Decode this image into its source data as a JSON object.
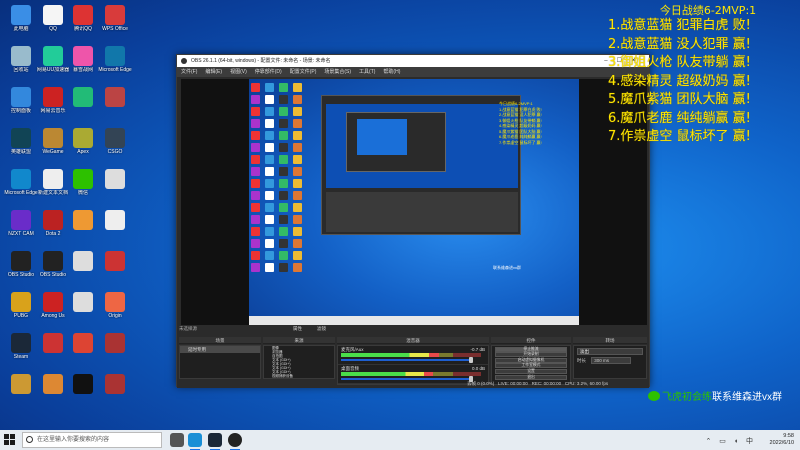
{
  "desktop": {
    "icons": [
      {
        "label": "此电脑",
        "color": "#3a8ee6"
      },
      {
        "label": "QQ",
        "color": "#f5f5f5"
      },
      {
        "label": "腾讯QQ",
        "color": "#d33"
      },
      {
        "label": "WPS Office",
        "color": "#d83b3b"
      },
      {
        "label": "回收站",
        "color": "#9bc"
      },
      {
        "label": "网易UU加速器",
        "color": "#2c9"
      },
      {
        "label": "暴雪战网",
        "color": "#e5a"
      },
      {
        "label": "Microsoft Edge",
        "color": "#17a"
      },
      {
        "label": "控制面板",
        "color": "#38d"
      },
      {
        "label": "网易云音乐",
        "color": "#c22"
      },
      {
        "label": "",
        "color": "#2b7"
      },
      {
        "label": "",
        "color": "#b44"
      },
      {
        "label": "英雄联盟",
        "color": "#145"
      },
      {
        "label": "WeGame",
        "color": "#b83"
      },
      {
        "label": "Apex",
        "color": "#aa3"
      },
      {
        "label": "CSGO",
        "color": "#345"
      },
      {
        "label": "Microsoft Edge",
        "color": "#18c"
      },
      {
        "label": "新建文本文档",
        "color": "#eee"
      },
      {
        "label": "微信",
        "color": "#2dc100"
      },
      {
        "label": "",
        "color": "#ddd"
      },
      {
        "label": "NZXT CAM",
        "color": "#6a2cc9"
      },
      {
        "label": "Dota 2",
        "color": "#b22"
      },
      {
        "label": "",
        "color": "#e93"
      },
      {
        "label": "",
        "color": "#eee"
      },
      {
        "label": "OBS Studio",
        "color": "#222"
      },
      {
        "label": "OBS Studio",
        "color": "#222"
      },
      {
        "label": "",
        "color": "#ddd"
      },
      {
        "label": "",
        "color": "#c33"
      },
      {
        "label": "PUBG",
        "color": "#d9a21b"
      },
      {
        "label": "Among Us",
        "color": "#c22"
      },
      {
        "label": "",
        "color": "#ddd"
      },
      {
        "label": "Origin",
        "color": "#e64"
      },
      {
        "label": "Steam",
        "color": "#1b2838"
      },
      {
        "label": "",
        "color": "#c33"
      },
      {
        "label": "",
        "color": "#d43"
      },
      {
        "label": "",
        "color": "#a33"
      },
      {
        "label": "",
        "color": "#c93"
      },
      {
        "label": "",
        "color": "#d83"
      },
      {
        "label": "",
        "color": "#111"
      },
      {
        "label": "",
        "color": "#a33"
      }
    ]
  },
  "obs": {
    "title": "OBS 26.1.1 (64-bit, windows) - 配置文件: 未命名 - 场景: 未命名",
    "menu": [
      "文件(F)",
      "编辑(E)",
      "视图(V)",
      "停靠部件(D)",
      "配置文件(P)",
      "场景集合(S)",
      "工具(T)",
      "帮助(H)"
    ],
    "scene_label": "未选择源",
    "properties_label": "属性",
    "filters_label": "滤镜",
    "docks": {
      "scenes": {
        "header": "场景",
        "items": [
          "延时专用"
        ]
      },
      "sources": {
        "header": "来源",
        "items": [
          "图像",
          "浏览器",
          "自拍图",
          "文本 (GDI+)",
          "文本 (GDI+)",
          "文本 (GDI+)",
          "文本 (GDI+)",
          "视频捕获设备",
          "显示器"
        ]
      },
      "mixer": {
        "header": "混音器",
        "channels": [
          {
            "name": "麦克风/Aux",
            "db": "-0.7 dB",
            "level": 0.7
          },
          {
            "name": "桌面音频",
            "db": "0.0 dB",
            "level": 0.66
          }
        ]
      },
      "transitions": {
        "header": "转场",
        "type": "淡出",
        "duration_label": "时长",
        "duration": "300 ms"
      },
      "controls": {
        "header": "控件",
        "buttons": [
          "停止推流",
          "开始录制",
          "启动虚拟摄像机",
          "工作室模式",
          "设置",
          "退出"
        ]
      }
    },
    "status": {
      "dropped": "丢帧 0 (0.0%)",
      "live": "LIVE: 00:00:00",
      "rec": "REC: 00:00:00",
      "cpu": "CPU: 3.2%, 60.00 fps"
    }
  },
  "overlay": {
    "title": "今日战绩6-2MVP:1",
    "lines": [
      "1.战意蓝猫 犯罪白虎 败!",
      "2.战意蓝猫 没人犯罪 赢!",
      "3.御姐火枪 队友带躺 赢!",
      "4.感染精灵 超级奶妈 赢!",
      "5.魔爪紫猫 团队大脑 赢!",
      "6.魔爪老鹿 纯纯躺赢 赢!",
      "7.作祟虚空 鼠标坏了 赢!"
    ]
  },
  "brand": {
    "highlight": "飞虎初会练",
    "text": "联系维森进vx群"
  },
  "taskbar": {
    "search_placeholder": "在这里输入你要搜索的内容",
    "time": "9:58",
    "date": "2022/6/10"
  },
  "colors": {
    "accent_yellow": "#ffe600",
    "wechat_green": "#2dc100",
    "obs_dark": "#2b2b2b"
  }
}
